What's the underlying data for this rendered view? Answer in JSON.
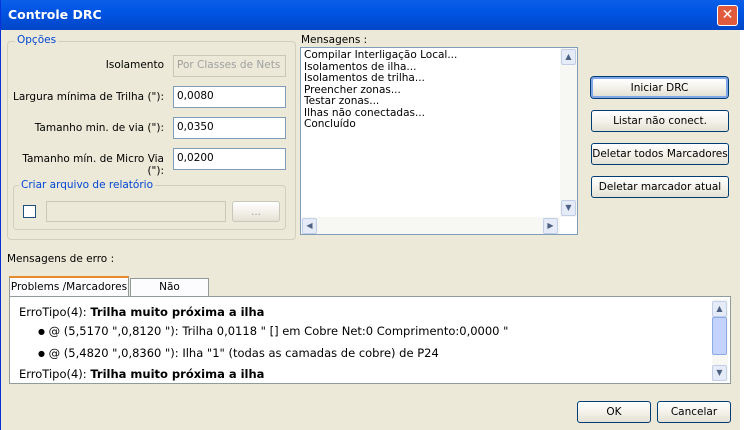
{
  "window": {
    "title": "Controle DRC",
    "close_symbol": "✕"
  },
  "options": {
    "group_label": "Opções",
    "isolation": {
      "label": "Isolamento",
      "value": "Por Classes de  Nets"
    },
    "track_width": {
      "label": "Largura mínima de Trilha (\"):",
      "value": "0,0080"
    },
    "via_size": {
      "label": "Tamanho min. de via (\"):",
      "value": "0,0350"
    },
    "microvia_size": {
      "label": "Tamanho mín. de Micro Via (\"):",
      "value": "0,0200"
    },
    "report": {
      "group_label": "Criar arquivo de relatório",
      "file_value": "",
      "browse_label": "..."
    }
  },
  "messages": {
    "label": "Mensagens :",
    "lines": [
      "Compilar Interligação Local...",
      "Isolamentos de ilha...",
      "Isolamentos de trilha...",
      "Preencher zonas...",
      "Testar zonas...",
      "Ilhas não conectadas...",
      "Concluído"
    ]
  },
  "actions": {
    "start": "Iniciar DRC",
    "list_unconnected": "Listar não conect.",
    "delete_all_markers": "Deletar todos Marcadores",
    "delete_current_marker": "Deletar marcador atual"
  },
  "errors": {
    "label": "Mensagens de erro :",
    "tabs": [
      "Problems /Marcadores",
      "Não conectado"
    ],
    "items": [
      {
        "prefix": "ErroTipo(4): ",
        "title": "Trilha muito próxima a ilha"
      },
      {
        "bullet": "@ (5,5170 \",0,8120 \"): Trilha 0,0118 \" [] em Cobre Net:0 Comprimento:0,0000 \""
      },
      {
        "bullet": "@ (5,4820 \",0,8360 \"): Ilha \"1\" (todas as camadas de cobre) de P24"
      },
      {
        "prefix": "ErroTipo(4): ",
        "title": "Trilha muito próxima a ilha"
      }
    ]
  },
  "footer": {
    "ok": "OK",
    "cancel": "Cancelar"
  },
  "icons": {
    "scroll_up": "▲",
    "scroll_down": "▼",
    "scroll_left": "◀",
    "scroll_right": "▶",
    "bullet": "●"
  }
}
